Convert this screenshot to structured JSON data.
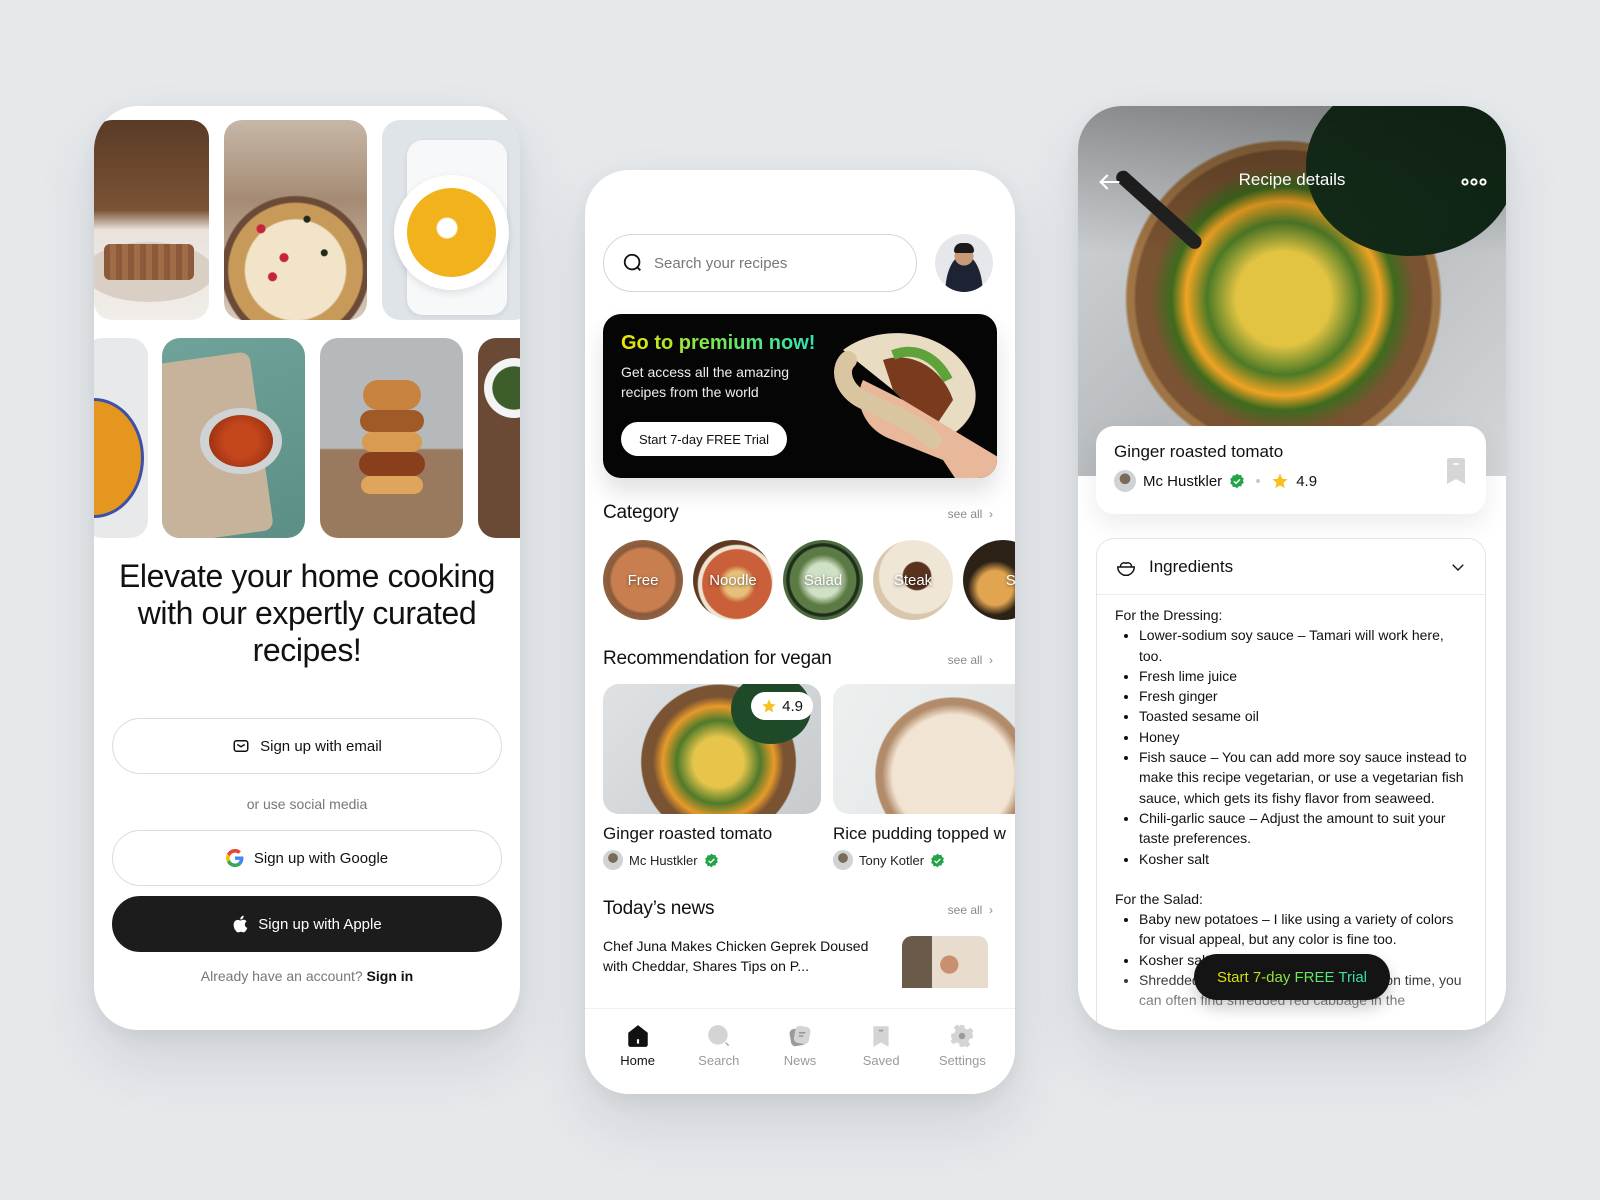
{
  "onboarding": {
    "headline": "Elevate your home cooking with our expertly curated recipes!",
    "gallery": [
      "waffles",
      "pizza",
      "pumpkin-soup",
      "carrot-soup",
      "minestrone",
      "chicken-burger",
      "salad"
    ],
    "email_button": "Sign up with email",
    "or_text": "or use social media",
    "google_button": "Sign up with Google",
    "apple_button": "Sign up with Apple",
    "account_prompt": "Already have an account?",
    "signin_link": "Sign in"
  },
  "home": {
    "search_placeholder": "Search your recipes",
    "promo": {
      "title": "Go to premium now!",
      "subtitle": "Get access all the amazing recipes from the world",
      "button": "Start 7-day FREE Trial"
    },
    "category": {
      "title": "Category",
      "see_all": "see all",
      "items": [
        "Free",
        "Noodle",
        "Salad",
        "Steak",
        "Ste"
      ]
    },
    "recommendation": {
      "title": "Recommendation for vegan",
      "see_all": "see all",
      "items": [
        {
          "title": "Ginger roasted tomato",
          "author": "Mc Hustkler",
          "rating": "4.9",
          "verified": true
        },
        {
          "title": "Rice pudding topped w",
          "author": "Tony Kotler",
          "rating": "",
          "verified": true
        }
      ]
    },
    "news": {
      "title": "Today’s news",
      "see_all": "see all",
      "headline": "Chef Juna Makes Chicken Geprek Doused with Cheddar, Shares Tips on P..."
    },
    "tabs": [
      {
        "label": "Home",
        "icon": "home-icon",
        "active": true
      },
      {
        "label": "Search",
        "icon": "search-icon",
        "active": false
      },
      {
        "label": "News",
        "icon": "news-icon",
        "active": false
      },
      {
        "label": "Saved",
        "icon": "bookmark-icon",
        "active": false
      },
      {
        "label": "Settings",
        "icon": "gear-icon",
        "active": false
      }
    ]
  },
  "details": {
    "nav_title": "Recipe details",
    "recipe_title": "Ginger roasted tomato",
    "author": "Mc Hustkler",
    "rating": "4.9",
    "ingredients_label": "Ingredients",
    "dressing_title": "For the Dressing:",
    "dressing": [
      "Lower-sodium soy sauce – Tamari will work here, too.",
      "Fresh lime juice",
      "Fresh ginger",
      "Toasted sesame oil",
      "Honey",
      "Fish sauce – You can add more soy sauce instead to make this recipe vegetarian, or use a vegetarian fish sauce, which gets its fishy flavor from seaweed.",
      "Chili-garlic sauce – Adjust the amount to suit your taste preferences.",
      "Kosher salt"
    ],
    "salad_title": "For the Salad:",
    "salad": [
      "Baby new potatoes – I like using a variety of colors for visual appeal, but any color is fine too.",
      "Kosher salt",
      "Shredded red cabbage – If you're short on time, you can often find shredded red cabbage in the"
    ],
    "cta": "Start 7-day FREE Trial"
  },
  "colors": {
    "background": "#e6e9ec",
    "dark_button": "#1c1c1c",
    "verified_green": "#22a447",
    "star_yellow": "#f7c01e",
    "gradient_start": "#f2e600",
    "gradient_end": "#2de3b8"
  }
}
